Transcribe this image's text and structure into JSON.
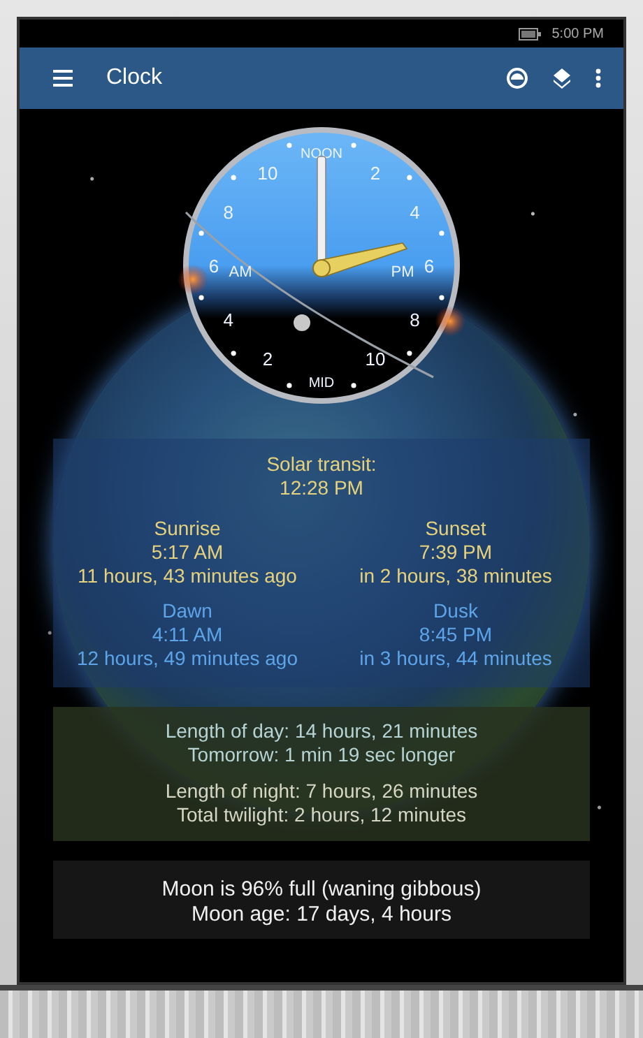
{
  "status_bar": {
    "time": "5:00 PM"
  },
  "app_bar": {
    "title": "Clock"
  },
  "clock": {
    "dial_labels": [
      "NOON",
      "2",
      "4",
      "6",
      "8",
      "10",
      "MID",
      "2",
      "4",
      "6",
      "8",
      "10"
    ],
    "am_label": "AM",
    "pm_label": "PM"
  },
  "solar_transit": {
    "label": "Solar transit:",
    "time": "12:28 PM"
  },
  "events": [
    {
      "kind": "sun",
      "name": "Sunrise",
      "time": "5:17 AM",
      "relative": "11 hours, 43 minutes ago"
    },
    {
      "kind": "sun",
      "name": "Sunset",
      "time": "7:39 PM",
      "relative": "in 2 hours, 38 minutes"
    },
    {
      "kind": "twilight",
      "name": "Dawn",
      "time": "4:11 AM",
      "relative": "12 hours, 49 minutes ago"
    },
    {
      "kind": "twilight",
      "name": "Dusk",
      "time": "8:45 PM",
      "relative": "in 3 hours, 44 minutes"
    }
  ],
  "day_stats": [
    {
      "kind": "day",
      "lines": [
        "Length of day: 14 hours, 21 minutes",
        "Tomorrow: 1 min 19 sec longer"
      ]
    },
    {
      "kind": "night",
      "lines": [
        "Length of night: 7 hours, 26 minutes",
        "Total twilight: 2 hours, 12 minutes"
      ]
    }
  ],
  "moon": {
    "lines": [
      "Moon is 96% full (waning gibbous)",
      "Moon age: 17 days, 4 hours"
    ]
  }
}
